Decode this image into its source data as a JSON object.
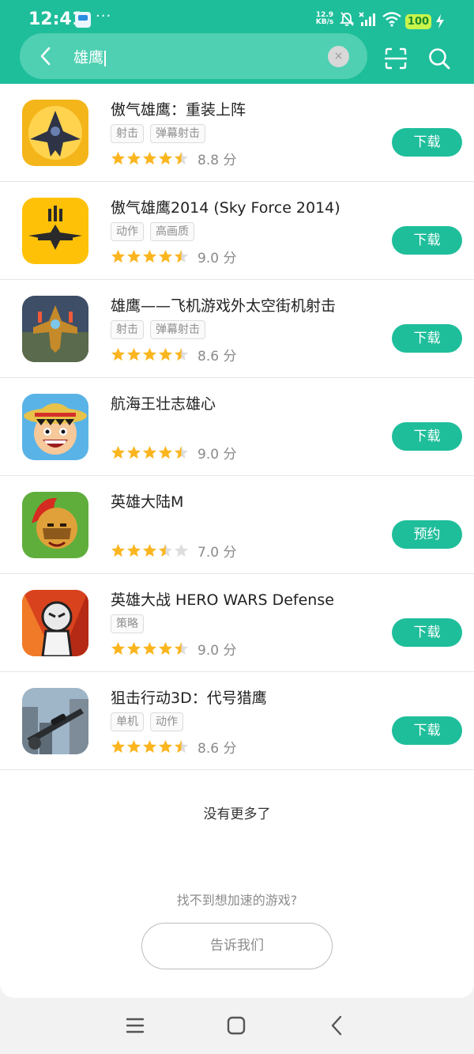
{
  "status_bar": {
    "time": "12:41",
    "more_dots": "···",
    "net_speed_value": "12.9",
    "net_speed_unit": "KB/s",
    "battery": "100"
  },
  "search": {
    "query": "雄鹰",
    "clear_symbol": "×"
  },
  "games": [
    {
      "name": "傲气雄鹰：重装上阵",
      "tags": [
        "射击",
        "弹幕射击"
      ],
      "stars": 4.5,
      "score": "8.8 分",
      "button": "下载"
    },
    {
      "name": "傲气雄鹰2014 (Sky Force 2014)",
      "tags": [
        "动作",
        "高画质"
      ],
      "stars": 4.5,
      "score": "9.0 分",
      "button": "下载"
    },
    {
      "name": "雄鹰——飞机游戏外太空街机射击",
      "tags": [
        "射击",
        "弹幕射击"
      ],
      "stars": 4.5,
      "score": "8.6 分",
      "button": "下载"
    },
    {
      "name": "航海王壮志雄心",
      "tags": [],
      "stars": 4.5,
      "score": "9.0 分",
      "button": "下载"
    },
    {
      "name": "英雄大陆M",
      "tags": [],
      "stars": 3.5,
      "score": "7.0 分",
      "button": "预约"
    },
    {
      "name": "英雄大战 HERO WARS Defense",
      "tags": [
        "策略"
      ],
      "stars": 4.5,
      "score": "9.0 分",
      "button": "下载"
    },
    {
      "name": "狙击行动3D：代号猎鹰",
      "tags": [
        "单机",
        "动作"
      ],
      "stars": 4.5,
      "score": "8.6 分",
      "button": "下载"
    }
  ],
  "footer": {
    "no_more": "没有更多了",
    "cant_find": "找不到想加速的游戏?",
    "tell_us": "告诉我们"
  },
  "colors": {
    "accent": "#1fbe9b",
    "star_on": "#fbb51f",
    "star_off": "#dddddd"
  }
}
